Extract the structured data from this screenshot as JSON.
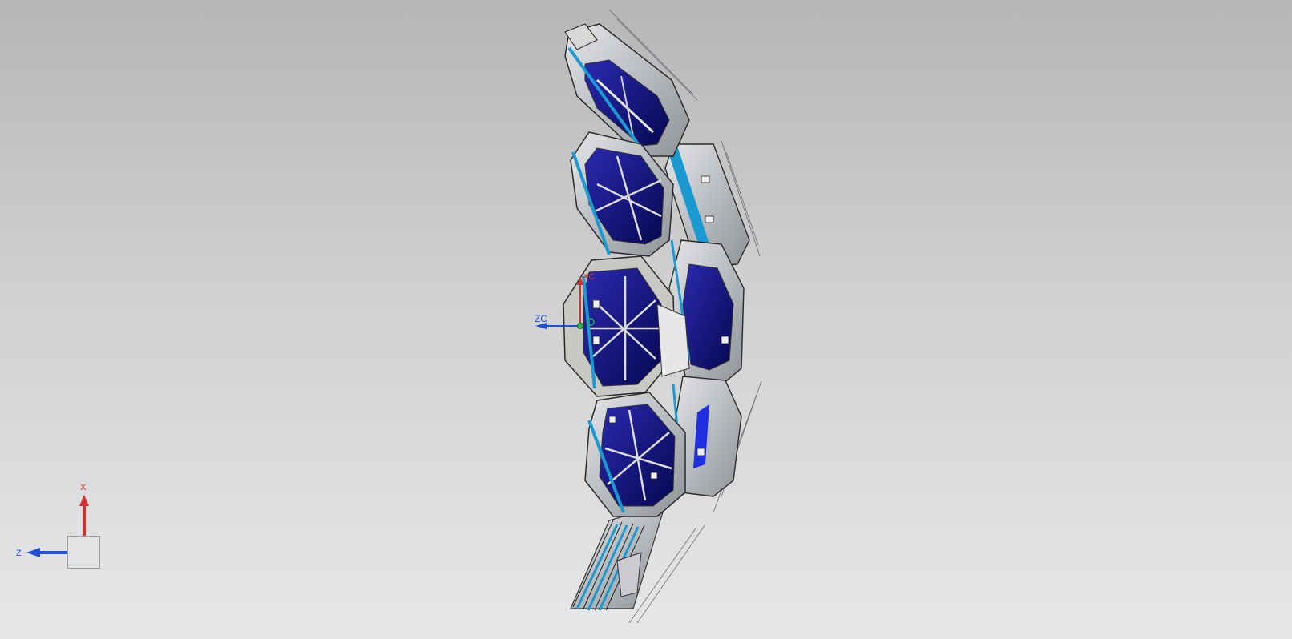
{
  "viewport": {
    "background_top": "#b5b6b8",
    "background_bottom": "#e6e7e9"
  },
  "colors": {
    "panel_blue": "#14148c",
    "panel_blue_dark": "#0a0a5c",
    "frame_gray": "#a9acb0",
    "frame_light": "#d8dadc",
    "accent_cyan": "#1a9ad0",
    "axis_red": "#d03030",
    "axis_blue": "#1f4fd8"
  },
  "wcs_triad": {
    "z_label": "ZC",
    "x_label": "XC"
  },
  "view_triad": {
    "x_label": "X",
    "z_label": "Z"
  }
}
